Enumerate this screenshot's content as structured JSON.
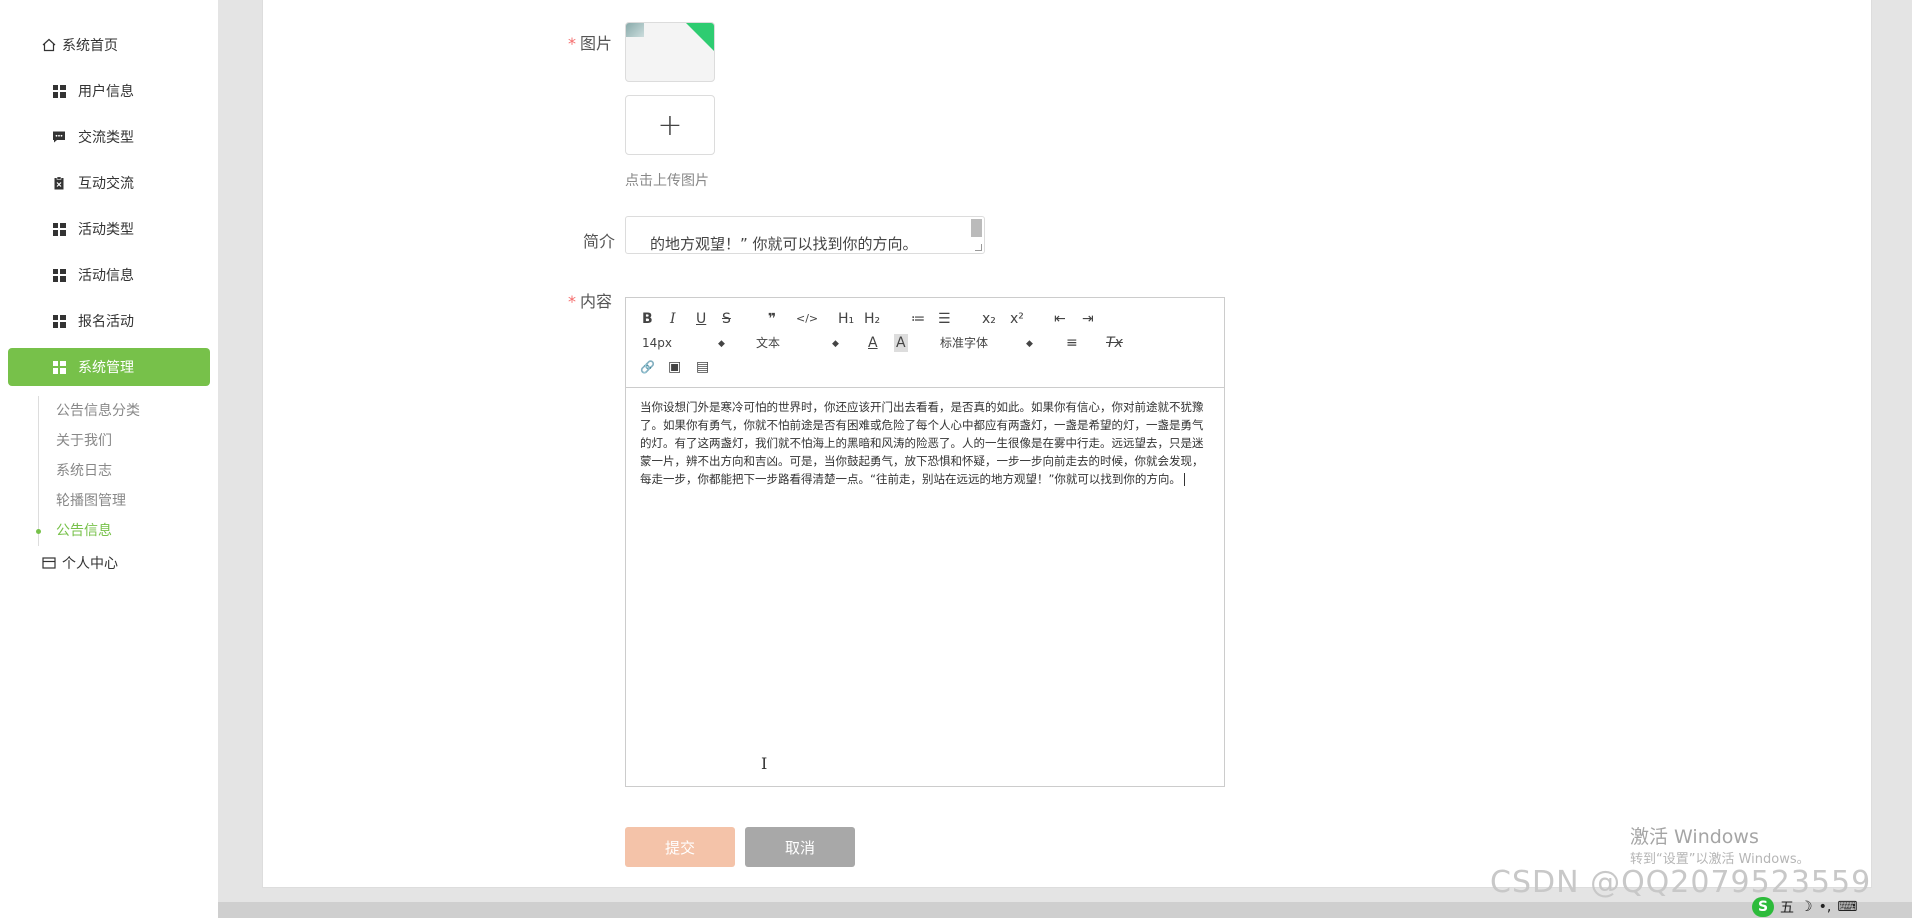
{
  "sidebar": {
    "home": "系统首页",
    "items": [
      {
        "label": "用户信息"
      },
      {
        "label": "交流类型"
      },
      {
        "label": "互动交流"
      },
      {
        "label": "活动类型"
      },
      {
        "label": "活动信息"
      },
      {
        "label": "报名活动"
      },
      {
        "label": "系统管理"
      }
    ],
    "sub_items": [
      {
        "label": "公告信息分类"
      },
      {
        "label": "关于我们"
      },
      {
        "label": "系统日志"
      },
      {
        "label": "轮播图管理"
      },
      {
        "label": "公告信息"
      }
    ],
    "profile": "个人中心"
  },
  "form": {
    "image_label": "图片",
    "upload_tip": "点击上传图片",
    "summary_label": "简介",
    "summary_value": "的地方观望！” 你就可以找到你的方向。",
    "content_label": "内容",
    "content_value": "当你设想门外是寒冷可怕的世界时，你还应该开门出去看看，是否真的如此。如果你有信心，你对前途就不犹豫了。如果你有勇气，你就不怕前途是否有困难或危险了每个人心中都应有两盏灯，一盏是希望的灯，一盏是勇气的灯。有了这两盏灯，我们就不怕海上的黑暗和风涛的险恶了。人的一生很像是在雾中行走。远远望去，只是迷蒙一片，辨不出方向和吉凶。可是，当你鼓起勇气，放下恐惧和怀疑，一步一步向前走去的时候，你就会发现，每走一步，你都能把下一步路看得清楚一点。“往前走，别站在远远的地方观望！”你就可以找到你的方向。",
    "submit": "提交",
    "cancel": "取消"
  },
  "toolbar": {
    "bold": "B",
    "italic": "I",
    "underline": "U",
    "strike": "S",
    "blockquote": "❞",
    "code": "</>",
    "h1": "H₁",
    "h2": "H₂",
    "ordered": "≔",
    "bullet": "☰",
    "sub": "x₂",
    "sup": "x²",
    "outdent": "⇤",
    "indent": "⇥",
    "size": "14px",
    "header": "文本",
    "font_color": "A",
    "bg_color": "A",
    "font": "标准字体",
    "align": "≡",
    "clean": "Tx",
    "link": "🔗",
    "image": "▣",
    "video": "▤"
  },
  "watermark": {
    "line1": "激活 Windows",
    "line2": "转到“设置”以激活 Windows。",
    "csdn": "CSDN @QQ2079523559"
  },
  "tray": {
    "ime": "五",
    "moon": "☽",
    "dots": "•,",
    "keyboard": "⌨",
    "icon": "S"
  }
}
